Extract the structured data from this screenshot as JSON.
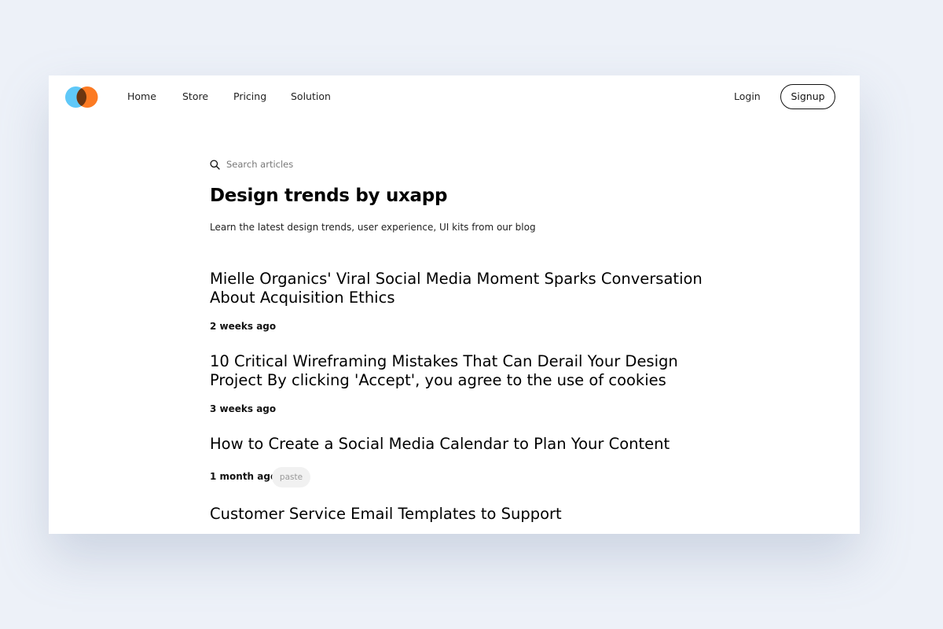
{
  "nav": {
    "links": [
      "Home",
      "Store",
      "Pricing",
      "Solution"
    ],
    "login": "Login",
    "signup": "Signup"
  },
  "search": {
    "placeholder": "Search articles"
  },
  "header": {
    "title": "Design trends by uxapp",
    "subtitle": "Learn the latest design trends, user experience, UI kits from our blog"
  },
  "articles": [
    {
      "title": "Mielle Organics' Viral Social Media Moment Sparks Conversation About Acquisition Ethics",
      "date": "2 weeks ago"
    },
    {
      "title": "10 Critical Wireframing Mistakes That Can Derail Your Design Project By clicking 'Accept', you agree to the use of cookies",
      "date": "3 weeks ago"
    },
    {
      "title": "How to Create a Social Media Calendar to Plan Your Content",
      "date": "1 month ago",
      "tag": "paste"
    },
    {
      "title": "Customer Service Email Templates to Support"
    }
  ],
  "colors": {
    "background": "#edf1f8",
    "logo_left": "#5fc8f8",
    "logo_right": "#fc7a22",
    "logo_overlap": "#6b3510"
  },
  "icons": {
    "logo": "overlapping-circles-logo",
    "search": "search-icon"
  }
}
